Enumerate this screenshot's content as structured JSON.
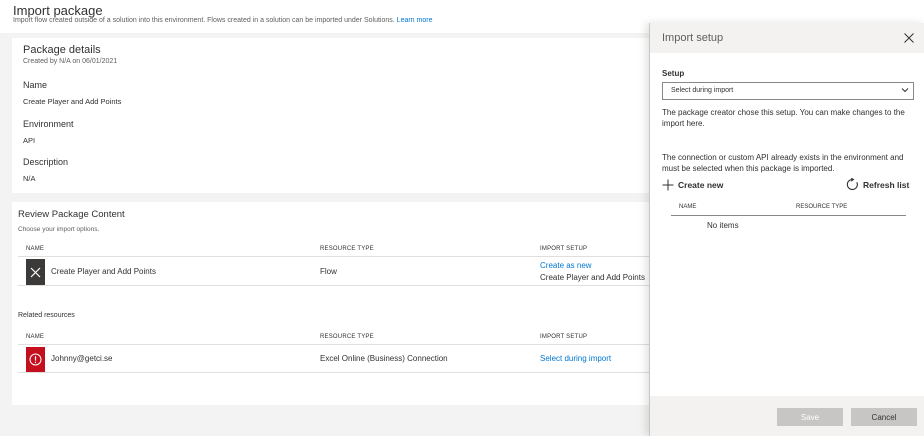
{
  "header": {
    "title": "Import package",
    "subtitle": "Import flow created outside of a solution into this environment. Flows created in a solution can be imported under Solutions.",
    "learn_more": "Learn more"
  },
  "package_details": {
    "title": "Package details",
    "created_by": "Created by N/A on 06/01/2021",
    "name_label": "Name",
    "name_value": "Create Player and Add Points",
    "environment_label": "Environment",
    "environment_value": "API",
    "description_label": "Description",
    "description_value": "N/A"
  },
  "review": {
    "title": "Review Package Content",
    "subtitle": "Choose your import options.",
    "columns": [
      "NAME",
      "RESOURCE TYPE",
      "IMPORT SETUP"
    ],
    "rows": [
      {
        "icon": "close-icon",
        "name": "Create Player and Add Points",
        "resource_type": "Flow",
        "import_setup_link": "Create as new",
        "import_setup_detail": "Create Player and Add Points"
      }
    ]
  },
  "related": {
    "title": "Related resources",
    "columns": [
      "NAME",
      "RESOURCE TYPE",
      "IMPORT SETUP"
    ],
    "rows": [
      {
        "icon": "error-icon",
        "name": "Johnny@getci.se",
        "resource_type": "Excel Online (Business) Connection",
        "import_setup_link": "Select during import"
      }
    ]
  },
  "panel": {
    "title": "Import setup",
    "setup_label": "Setup",
    "setup_selected": "Select during import",
    "info_text": "The package creator chose this setup. You can make changes to the import here.",
    "connection_text": "The connection or custom API already exists in the environment and must be selected when this package is imported.",
    "create_new": "Create new",
    "refresh_list": "Refresh list",
    "columns": [
      "NAME",
      "RESOURCE TYPE"
    ],
    "empty_text": "No items",
    "save_label": "Save",
    "cancel_label": "Cancel"
  },
  "colors": {
    "accent": "#0078d4",
    "error": "#c50f1f",
    "flow_icon_bg": "#3b3a39",
    "disabled_button": "#c8c6c4"
  }
}
